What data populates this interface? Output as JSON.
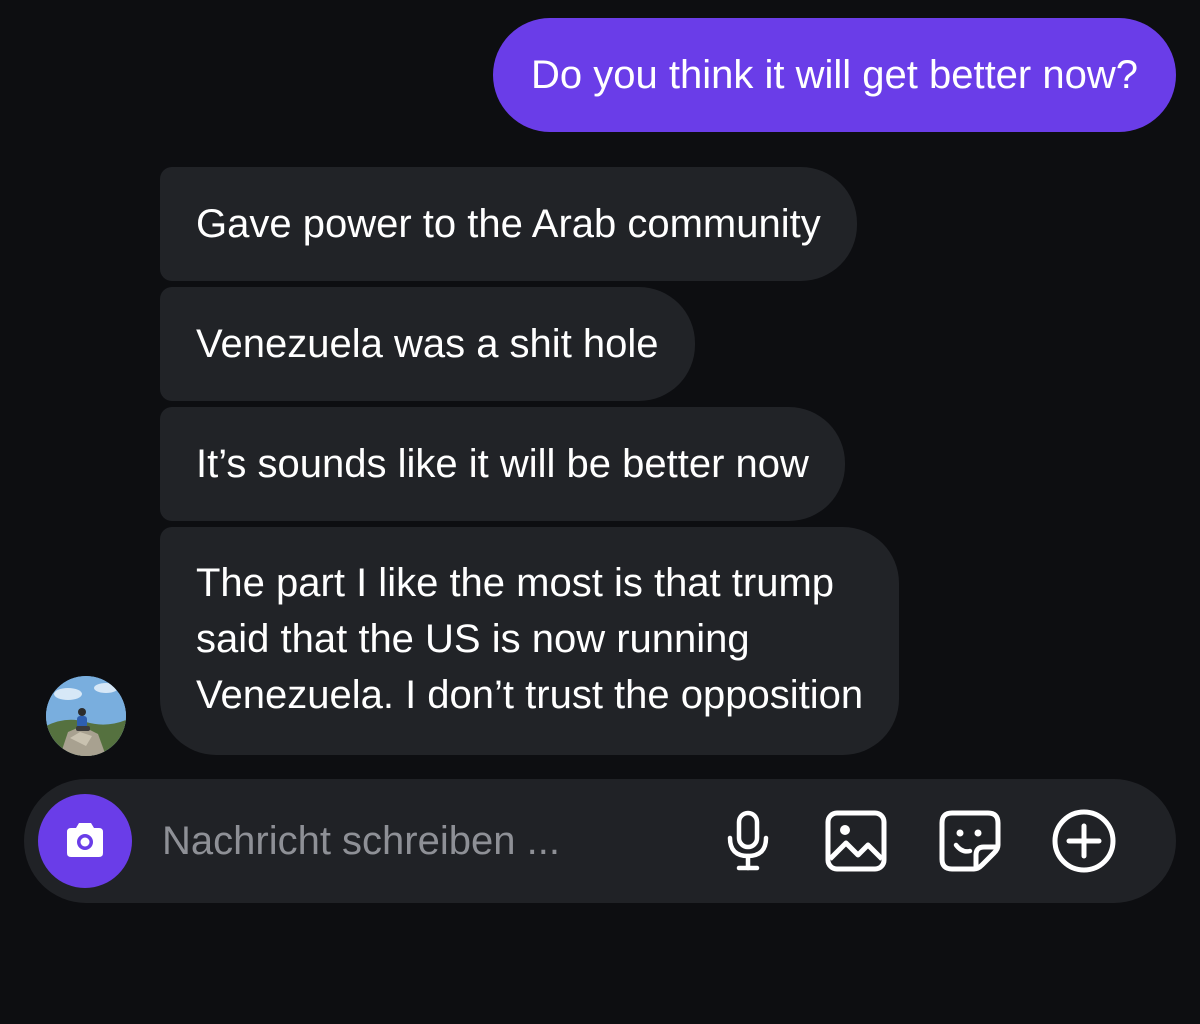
{
  "messages": {
    "sent": [
      {
        "text": "Do you think it will get better now?"
      }
    ],
    "received": [
      {
        "text": "Gave power to the Arab community"
      },
      {
        "text": "Venezuela was a shit hole"
      },
      {
        "text": "It’s sounds like it will be better now"
      },
      {
        "lines": [
          "The part I like the most is that trump",
          "said that the US is now running",
          "Venezuela. I don’t trust the opposition"
        ]
      }
    ]
  },
  "composer": {
    "placeholder": "Nachricht schreiben ...",
    "icons": [
      "camera-icon",
      "microphone-icon",
      "image-icon",
      "sticker-icon",
      "plus-circle-icon"
    ]
  },
  "colors": {
    "background": "#0d0e11",
    "sent_bubble": "#6a3de8",
    "received_bubble": "#212327",
    "composer": "#202226",
    "placeholder_text": "#8e9096"
  }
}
